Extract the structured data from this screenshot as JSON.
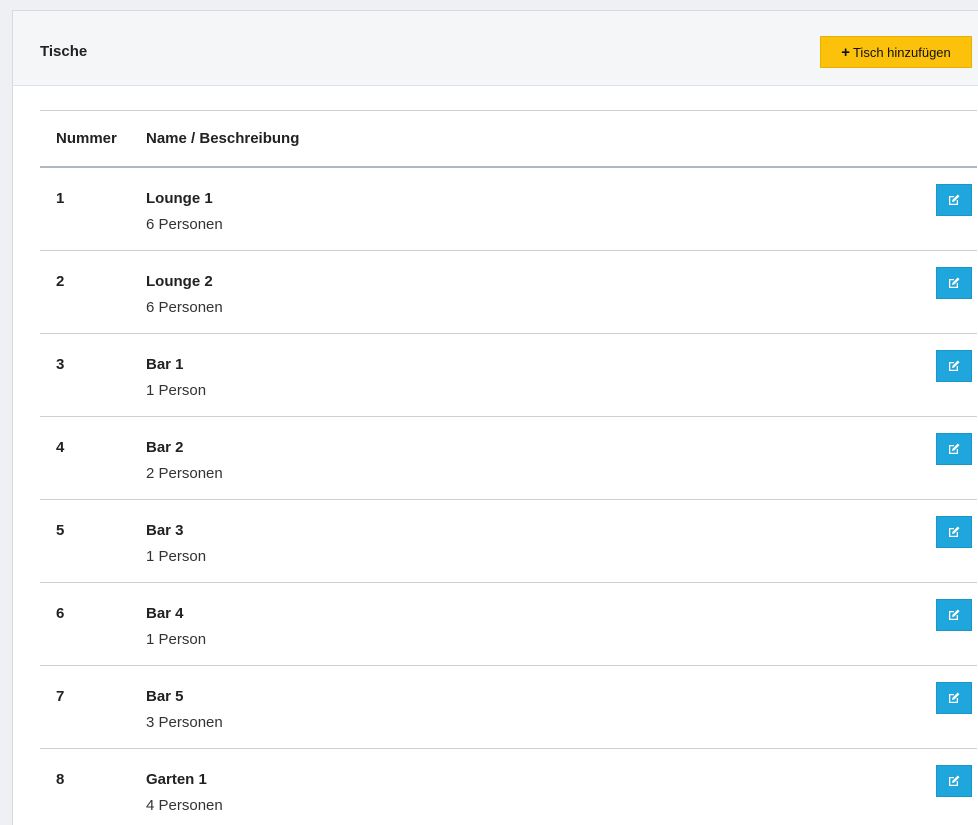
{
  "panel": {
    "title": "Tische",
    "add_button_label": "Tisch hinzufügen",
    "add_button_icon": "plus-icon",
    "add_button_color": "#fcc20b"
  },
  "table": {
    "columns": [
      "Nummer",
      "Name / Beschreibung"
    ],
    "edit_icon": "edit-icon",
    "edit_button_color": "#1fa6dd",
    "rows": [
      {
        "number": "1",
        "name": "Lounge 1",
        "description": "6 Personen"
      },
      {
        "number": "2",
        "name": "Lounge 2",
        "description": "6 Personen"
      },
      {
        "number": "3",
        "name": "Bar 1",
        "description": "1 Person"
      },
      {
        "number": "4",
        "name": "Bar 2",
        "description": "2 Personen"
      },
      {
        "number": "5",
        "name": "Bar 3",
        "description": "1 Person"
      },
      {
        "number": "6",
        "name": "Bar 4",
        "description": "1 Person"
      },
      {
        "number": "7",
        "name": "Bar 5",
        "description": "3 Personen"
      },
      {
        "number": "8",
        "name": "Garten 1",
        "description": "4 Personen"
      }
    ]
  }
}
